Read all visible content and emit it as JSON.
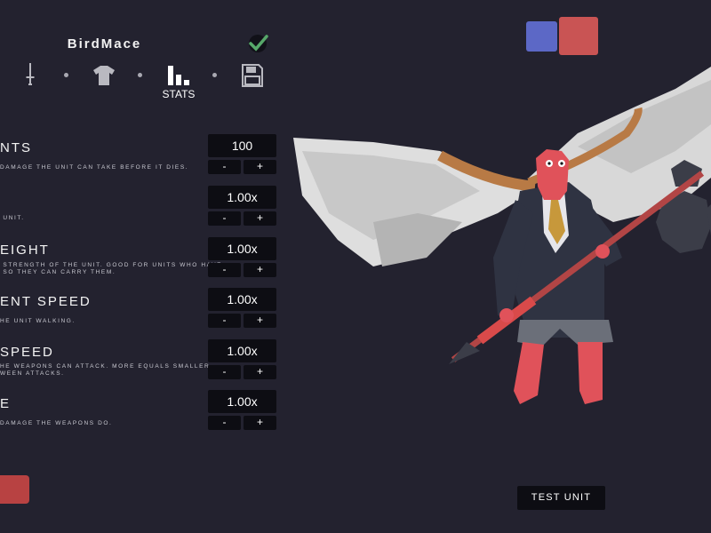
{
  "header": {
    "unit_name": "BirdMace"
  },
  "tabs": [
    {
      "icon": "sword-icon"
    },
    {
      "icon": "shirt-icon"
    },
    {
      "icon": "stats-icon",
      "label": "STATS"
    },
    {
      "icon": "save-icon"
    }
  ],
  "stats": [
    {
      "title": "NTS",
      "desc": "DAMAGE THE UNIT CAN TAKE BEFORE IT DIES.",
      "value": "100"
    },
    {
      "title": "",
      "desc": " UNIT.",
      "value": "1.00x"
    },
    {
      "title": "EIGHT",
      "desc": " STRENGTH OF THE UNIT. GOOD FOR UNITS WHO HAVE\n SO THEY CAN CARRY THEM.",
      "value": "1.00x"
    },
    {
      "title": "ENT SPEED",
      "desc": "HE UNIT WALKING.",
      "value": "1.00x"
    },
    {
      "title": " SPEED",
      "desc": "HE WEAPONS CAN ATTACK. MORE EQUALS SMALLER\nWEEN ATTACKS.",
      "value": "1.00x"
    },
    {
      "title": "E",
      "desc": "DAMAGE THE WEAPONS DO.",
      "value": "1.00x"
    }
  ],
  "buttons": {
    "minus": "-",
    "plus": "+"
  },
  "test_unit": "TEST UNIT",
  "colors": {
    "team_blue": "#5c68c6",
    "team_red": "#c95454",
    "background": "#23222f"
  }
}
